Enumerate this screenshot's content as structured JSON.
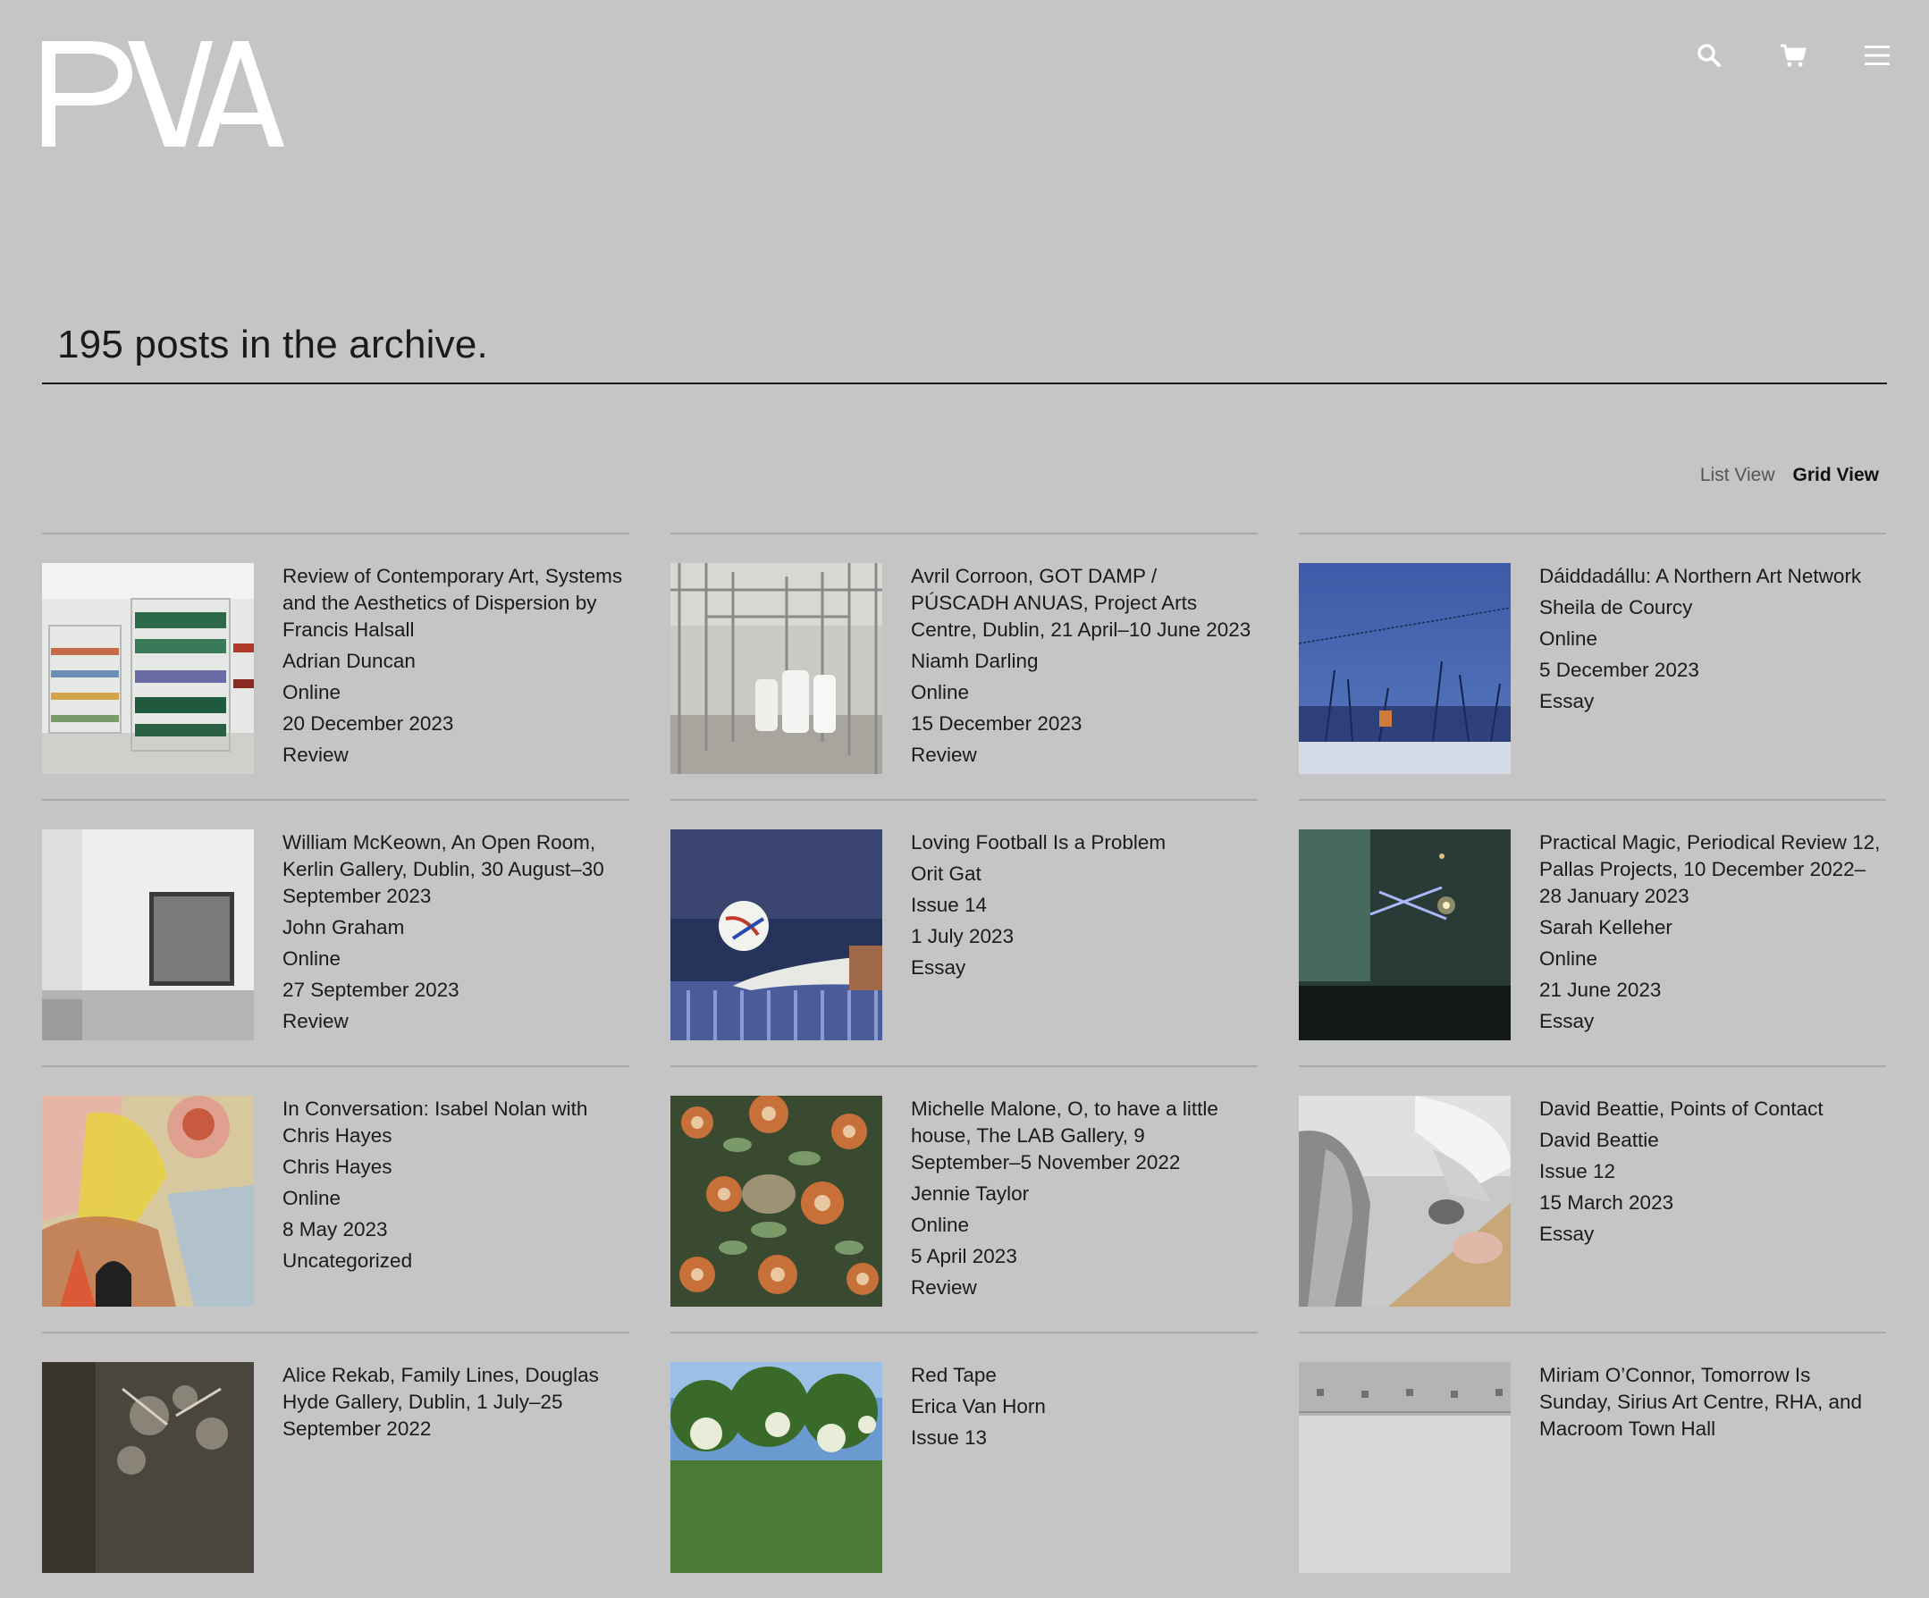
{
  "site": {
    "logo_text": "PVA"
  },
  "header": {
    "icons": [
      "search-icon",
      "cart-icon",
      "menu-icon"
    ]
  },
  "archive": {
    "title": "195 posts in the archive."
  },
  "view_toggle": {
    "list_label": "List View",
    "grid_label": "Grid View",
    "active": "Grid View"
  },
  "posts": [
    {
      "title": "Review of Contemporary Art, Systems and the Aesthetics of Dispersion by Francis Halsall",
      "author": "Adrian Duncan",
      "issue": "Online",
      "date": "20 December 2023",
      "category": "Review",
      "thumb": "shelves"
    },
    {
      "title": "Avril Corroon, GOT DAMP / PÚSCADH ANUAS, Project Arts Centre, Dublin, 21 April–10 June 2023",
      "author": "Niamh Darling",
      "issue": "Online",
      "date": "15 December 2023",
      "category": "Review",
      "thumb": "cage"
    },
    {
      "title": "Dáiddadállu: A Northern Art Network",
      "author": "Sheila de Courcy",
      "issue": "Online",
      "date": "5 December 2023",
      "category": "Essay",
      "thumb": "winter"
    },
    {
      "title": "William McKeown, An Open Room, Kerlin Gallery, Dublin, 30 August–30 September 2023",
      "author": "John Graham",
      "issue": "Online",
      "date": "27 September 2023",
      "category": "Review",
      "thumb": "gallery"
    },
    {
      "title": "Loving Football Is a Problem",
      "author": "Orit Gat",
      "issue": "Issue 14",
      "date": "1 July 2023",
      "category": "Essay",
      "thumb": "football"
    },
    {
      "title": "Practical Magic, Periodical Review 12, Pallas Projects, 10 December 2022–28 January 2023",
      "author": "Sarah Kelleher",
      "issue": "Online",
      "date": "21 June 2023",
      "category": "Essay",
      "thumb": "dark"
    },
    {
      "title": "In Conversation: Isabel Nolan with Chris Hayes",
      "author": "Chris Hayes",
      "issue": "Online",
      "date": "8 May 2023",
      "category": "Uncategorized",
      "thumb": "painting"
    },
    {
      "title": "Michelle Malone, O, to have a little house, The LAB Gallery, 9 September–5 November 2022",
      "author": "Jennie Taylor",
      "issue": "Online",
      "date": "5 April 2023",
      "category": "Review",
      "thumb": "floral"
    },
    {
      "title": "David Beattie, Points of Contact",
      "author": "David Beattie",
      "issue": "Issue 12",
      "date": "15 March 2023",
      "category": "Essay",
      "thumb": "robot"
    },
    {
      "title": "Alice Rekab, Family Lines, Douglas Hyde Gallery, Dublin, 1 July–25 September 2022",
      "author": "",
      "issue": "",
      "date": "",
      "category": "",
      "thumb": "rubble"
    },
    {
      "title": "Red Tape",
      "author": "Erica Van Horn",
      "issue": "Issue 13",
      "date": "",
      "category": "",
      "thumb": "trees"
    },
    {
      "title": "Miriam O’Connor, Tomorrow Is Sunday, Sirius Art Centre, RHA, and Macroom Town Hall",
      "author": "",
      "issue": "",
      "date": "",
      "category": "",
      "thumb": "room"
    }
  ],
  "colors": {
    "background": "#c5c5c5",
    "text": "#1a1a1a",
    "divider": "#a9a9a9",
    "logo": "#ffffff"
  }
}
